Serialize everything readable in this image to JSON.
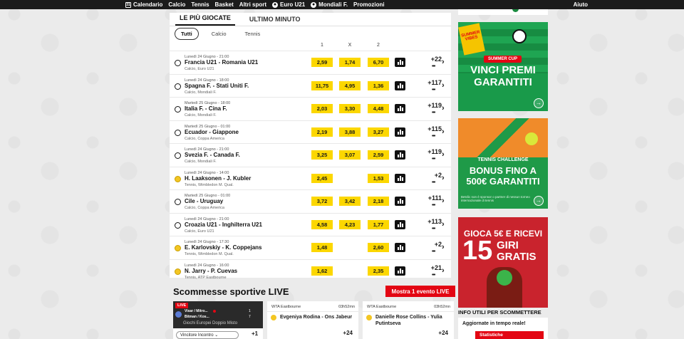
{
  "nav": {
    "items": [
      {
        "label": "Calendario",
        "icon": "calendar-icon"
      },
      {
        "label": "Calcio"
      },
      {
        "label": "Tennis"
      },
      {
        "label": "Basket"
      },
      {
        "label": "Altri sport"
      },
      {
        "label": "Euro U21",
        "icon": "soccer-ball-icon"
      },
      {
        "label": "Mondiali F.",
        "icon": "soccer-ball-icon"
      },
      {
        "label": "Promozioni"
      }
    ],
    "help": "Aiuto",
    "calendar_glyph": "31"
  },
  "panel": {
    "tabs": [
      {
        "label": "LE PIÙ GIOCATE",
        "active": true
      },
      {
        "label": "ULTIMO MINUTO",
        "active": false
      }
    ],
    "filters": [
      {
        "label": "Tutti",
        "active": true
      },
      {
        "label": "Calcio",
        "active": false
      },
      {
        "label": "Tennis",
        "active": false
      }
    ],
    "columns": [
      "1",
      "X",
      "2"
    ],
    "rows": [
      {
        "sport": "soccer",
        "date": "Lunedì 24 Giugno - 21:00",
        "match": "Francia U21 - Romania U21",
        "comp": "Calcio, Euro U21",
        "o1": "2,59",
        "ox": "1,74",
        "o2": "6,70",
        "more": "+22"
      },
      {
        "sport": "soccer",
        "date": "Lunedì 24 Giugno - 18:00",
        "match": "Spagna F. - Stati Uniti F.",
        "comp": "Calcio, Mondiali F.",
        "o1": "11,75",
        "ox": "4,95",
        "o2": "1,36",
        "more": "+117"
      },
      {
        "sport": "soccer",
        "date": "Martedì 25 Giugno - 18:00",
        "match": "Italia F. - Cina F.",
        "comp": "Calcio, Mondiali F.",
        "o1": "2,03",
        "ox": "3,30",
        "o2": "4,48",
        "more": "+119"
      },
      {
        "sport": "soccer",
        "date": "Martedì 25 Giugno - 01:00",
        "match": "Ecuador - Giappone",
        "comp": "Calcio, Coppa America",
        "o1": "2,19",
        "ox": "3,88",
        "o2": "3,27",
        "more": "+115"
      },
      {
        "sport": "soccer",
        "date": "Lunedì 24 Giugno - 21:00",
        "match": "Svezia F. - Canada F.",
        "comp": "Calcio, Mondiali F.",
        "o1": "3,25",
        "ox": "3,07",
        "o2": "2,59",
        "more": "+119"
      },
      {
        "sport": "tennis",
        "date": "Lunedì 24 Giugno - 14:00",
        "match": "H. Laaksonen - J. Kubler",
        "comp": "Tennis, Wimbledon M. Qual.",
        "o1": "2,45",
        "ox": "",
        "o2": "1,53",
        "more": "+2"
      },
      {
        "sport": "soccer",
        "date": "Martedì 25 Giugno - 01:00",
        "match": "Cile - Uruguay",
        "comp": "Calcio, Coppa America",
        "o1": "3,72",
        "ox": "3,42",
        "o2": "2,18",
        "more": "+111"
      },
      {
        "sport": "soccer",
        "date": "Lunedì 24 Giugno - 21:00",
        "match": "Croazia U21 - Inghilterra U21",
        "comp": "Calcio, Euro U21",
        "o1": "4,58",
        "ox": "4,23",
        "o2": "1,77",
        "more": "+113"
      },
      {
        "sport": "tennis",
        "date": "Lunedì 24 Giugno - 17:30",
        "match": "E. Karlovskiy - K. Coppejans",
        "comp": "Tennis, Wimbledon M. Qual.",
        "o1": "1,48",
        "ox": "",
        "o2": "2,60",
        "more": "+2"
      },
      {
        "sport": "tennis",
        "date": "Lunedì 24 Giugno - 16:00",
        "match": "N. Jarry - P. Cuevas",
        "comp": "Tennis, ATP Eastbourne",
        "o1": "1,62",
        "ox": "",
        "o2": "2,35",
        "more": "+21"
      }
    ]
  },
  "live": {
    "title": "Scommesse sportive LIVE",
    "button": "Mostra 1 evento LIVE",
    "card1": {
      "badge": "LIVE",
      "p1": "Visar / Mitro...",
      "p2": "Bitman / Kos...",
      "s1": "1",
      "s2": "7",
      "game": "Giochi Europei Doppio Misto",
      "select": "Vincitore Incontro",
      "more": "+1"
    },
    "card2": {
      "comp": "WTA Eastbourne",
      "time": "03h52mn",
      "match": "Evgeniya Rodina - Ons Jabeur",
      "more": "+24"
    },
    "card3": {
      "comp": "WTA Eastbourne",
      "time": "03h52mn",
      "match": "Danielle Rose Collins - Yulia Putintseva",
      "more": "+24"
    }
  },
  "ads": {
    "ad1": {
      "flag": "SUMMER VIBES",
      "tag": "SUMMER CUP",
      "line1": "VINCI PREMI",
      "line2": "GARANTITI"
    },
    "ad2": {
      "label": "TENNIS CHALLENGE",
      "line1": "BONUS FINO A",
      "line2": "500€ GARANTITI",
      "small": "Betclic non è sponsor o partner di nessun torneo internazionale di tennis"
    },
    "ad3": {
      "line1": "GIOCA 5€ E RICEVI",
      "num": "15",
      "line2": "GIRI",
      "line3": "GRATIS"
    }
  },
  "info": {
    "title": "INFO UTILI PER SCOMMETTERE",
    "subtitle": "Aggiornate in tempo reale!",
    "button": "Statistiche"
  },
  "colors": {
    "odds": "#fcd700",
    "live_red": "#e30613",
    "nav_bg": "#1b1b1b"
  }
}
